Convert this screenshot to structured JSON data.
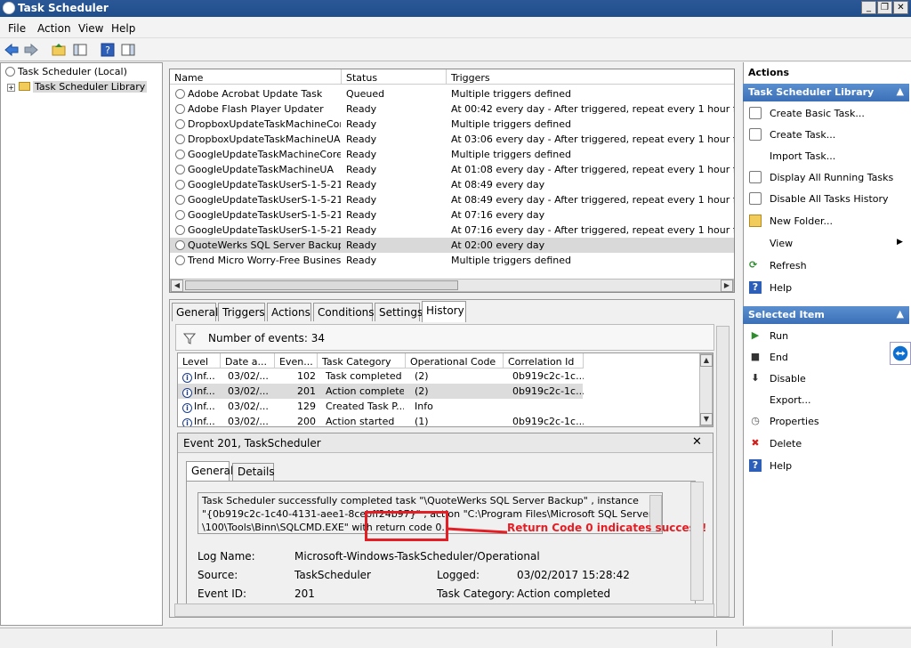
{
  "window": {
    "title": "Task Scheduler"
  },
  "menu": {
    "file": "File",
    "action": "Action",
    "view": "View",
    "help": "Help"
  },
  "tree": {
    "root": "Task Scheduler (Local)",
    "library": "Task Scheduler Library"
  },
  "task_list": {
    "columns": [
      "Name",
      "Status",
      "Triggers"
    ],
    "rows": [
      {
        "name": "Adobe Acrobat Update Task",
        "status": "Queued",
        "triggers": "Multiple triggers defined"
      },
      {
        "name": "Adobe Flash Player Updater",
        "status": "Ready",
        "triggers": "At 00:42 every day - After triggered, repeat every 1 hour for a du"
      },
      {
        "name": "DropboxUpdateTaskMachineCore",
        "status": "Ready",
        "triggers": "Multiple triggers defined"
      },
      {
        "name": "DropboxUpdateTaskMachineUA",
        "status": "Ready",
        "triggers": "At 03:06 every day - After triggered, repeat every 1 hour for a du"
      },
      {
        "name": "GoogleUpdateTaskMachineCore",
        "status": "Ready",
        "triggers": "Multiple triggers defined"
      },
      {
        "name": "GoogleUpdateTaskMachineUA",
        "status": "Ready",
        "triggers": "At 01:08 every day - After triggered, repeat every 1 hour for a du"
      },
      {
        "name": "GoogleUpdateTaskUserS-1-5-21...",
        "status": "Ready",
        "triggers": "At 08:49 every day"
      },
      {
        "name": "GoogleUpdateTaskUserS-1-5-21...",
        "status": "Ready",
        "triggers": "At 08:49 every day - After triggered, repeat every 1 hour for a du"
      },
      {
        "name": "GoogleUpdateTaskUserS-1-5-21...",
        "status": "Ready",
        "triggers": "At 07:16 every day"
      },
      {
        "name": "GoogleUpdateTaskUserS-1-5-21...",
        "status": "Ready",
        "triggers": "At 07:16 every day - After triggered, repeat every 1 hour for a du"
      },
      {
        "name": "QuoteWerks SQL Server Backup",
        "status": "Ready",
        "triggers": "At 02:00 every day"
      },
      {
        "name": "Trend Micro Worry-Free Busines...",
        "status": "Ready",
        "triggers": "Multiple triggers defined"
      }
    ]
  },
  "tabs": [
    "General",
    "Triggers",
    "Actions",
    "Conditions",
    "Settings",
    "History"
  ],
  "history": {
    "count_label": "Number of events: 34",
    "columns": [
      "Level",
      "Date a...",
      "Even...",
      "Task Category",
      "Operational Code",
      "Correlation Id"
    ],
    "rows": [
      {
        "level": "Inf...",
        "date": "03/02/...",
        "event": "102",
        "category": "Task completed",
        "opcode": "(2)",
        "corr": "0b919c2c-1c..."
      },
      {
        "level": "Inf...",
        "date": "03/02/...",
        "event": "201",
        "category": "Action completed",
        "opcode": "(2)",
        "corr": "0b919c2c-1c..."
      },
      {
        "level": "Inf...",
        "date": "03/02/...",
        "event": "129",
        "category": "Created Task P...",
        "opcode": "Info",
        "corr": ""
      },
      {
        "level": "Inf...",
        "date": "03/02/...",
        "event": "200",
        "category": "Action started",
        "opcode": "(1)",
        "corr": "0b919c2c-1c..."
      }
    ]
  },
  "event_detail": {
    "title": "Event 201, TaskScheduler",
    "tabs": [
      "General",
      "Details"
    ],
    "message_line1": "Task Scheduler successfully completed task \"\\QuoteWerks SQL Server Backup\" , instance",
    "message_line2": "\"{0b919c2c-1c40-4131-aee1-8cebff",
    "message_line2b": "24b97}\" , action \"C:\\Program Files\\Microsoft SQL Server",
    "message_line3": "\\100\\Tools\\Binn\\SQLCMD.EXE\" with return code 0.",
    "log_name_label": "Log Name:",
    "log_name": "Microsoft-Windows-TaskScheduler/Operational",
    "source_label": "Source:",
    "source": "TaskScheduler",
    "logged_label": "Logged:",
    "logged": "03/02/2017 15:28:42",
    "event_id_label": "Event ID:",
    "event_id": "201",
    "task_category_label": "Task Category:",
    "task_category": "Action completed"
  },
  "annotation": {
    "text": "Return Code 0 indicates success!",
    "color": "#e31e24"
  },
  "actions": {
    "title": "Actions",
    "library_header": "Task Scheduler Library",
    "library_items": [
      "Create Basic Task...",
      "Create Task...",
      "Import Task...",
      "Display All Running Tasks",
      "Disable All Tasks History",
      "New Folder...",
      "View",
      "Refresh",
      "Help"
    ],
    "selected_header": "Selected Item",
    "selected_items": [
      "Run",
      "End",
      "Disable",
      "Export...",
      "Properties",
      "Delete",
      "Help"
    ]
  }
}
